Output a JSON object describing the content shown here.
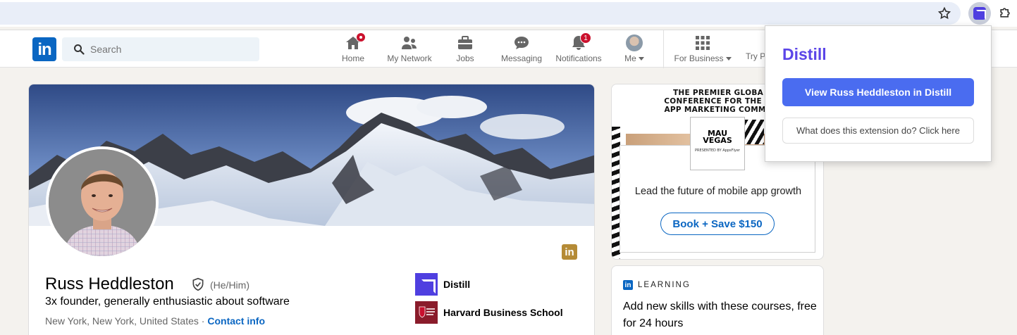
{
  "linkedin": {
    "search": {
      "placeholder": "Search"
    },
    "nav": {
      "home": "Home",
      "network": "My Network",
      "jobs": "Jobs",
      "messaging": "Messaging",
      "notifications": "Notifications",
      "notifications_count": "1",
      "me": "Me",
      "for_business": "For Business",
      "try_premium": "Try P"
    }
  },
  "profile": {
    "name": "Russ Heddleston",
    "pronouns": "(He/Him)",
    "headline": "3x founder, generally enthusiastic about software",
    "location": "New York, New York, United States",
    "location_sep": " · ",
    "contact_info": "Contact info",
    "orgs": [
      {
        "name": "Distill"
      },
      {
        "name": "Harvard Business School"
      }
    ]
  },
  "ad": {
    "headline_lines": [
      "THE PREMIER GLOBA",
      "CONFERENCE FOR THE M",
      "APP MARKETING COMMU"
    ],
    "logo_line1": "MAU",
    "logo_line2": "VEGAS",
    "logo_sub": "PRESENTED BY AppsFlyer",
    "tagline": "Lead the future of mobile app growth",
    "cta": "Book + Save $150"
  },
  "learning": {
    "label": "LEARNING",
    "text": "Add new skills with these courses, free for 24 hours"
  },
  "extension_popup": {
    "title": "Distill",
    "primary_button": "View Russ Heddleston in Distill",
    "secondary_button": "What does this extension do? Click here"
  },
  "colors": {
    "linkedin_blue": "#0a66c2",
    "distill_purple": "#5b45e8",
    "button_blue": "#4a6cf0",
    "notification_red": "#cb112d"
  }
}
